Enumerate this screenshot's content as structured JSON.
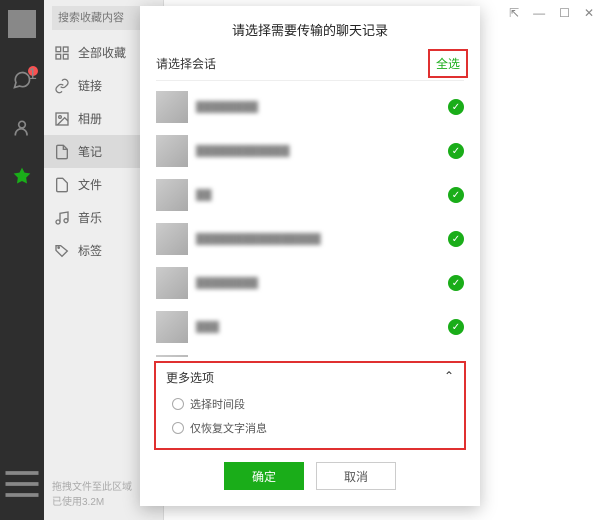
{
  "leftbar": {
    "badge": "1"
  },
  "sidebar": {
    "search_placeholder": "搜索收藏内容",
    "items": [
      {
        "label": "全部收藏"
      },
      {
        "label": "链接"
      },
      {
        "label": "相册"
      },
      {
        "label": "笔记"
      },
      {
        "label": "文件"
      },
      {
        "label": "音乐"
      },
      {
        "label": "标签"
      }
    ],
    "footer_line1": "拖拽文件至此区域",
    "footer_line2": "已使用3.2M"
  },
  "dialog": {
    "title": "请选择需要传输的聊天记录",
    "select_chat_label": "请选择会话",
    "select_all_label": "全选",
    "chats": [
      {
        "name": "████████"
      },
      {
        "name": "████████████"
      },
      {
        "name": "██"
      },
      {
        "name": "████████████████"
      },
      {
        "name": "████████"
      },
      {
        "name": "███"
      },
      {
        "name": "██████████"
      }
    ],
    "more_options_label": "更多选项",
    "option_time_range": "选择时间段",
    "option_text_only": "仅恢复文字消息",
    "ok_label": "确定",
    "cancel_label": "取消"
  },
  "colors": {
    "accent": "#1aad19",
    "danger": "#e03030"
  }
}
